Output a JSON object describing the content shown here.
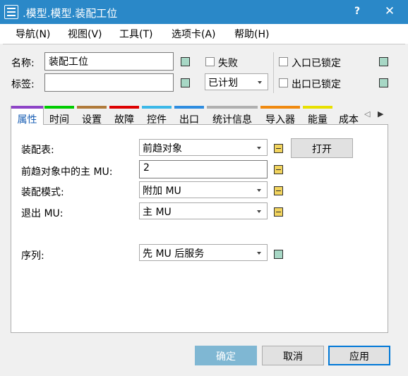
{
  "window": {
    "title": ".模型.模型.装配工位",
    "help_label": "?",
    "close_label": "✕",
    "app_icon": "station-icon"
  },
  "menu": [
    {
      "label": "导航(N)"
    },
    {
      "label": "视图(V)"
    },
    {
      "label": "工具(T)"
    },
    {
      "label": "选项卡(A)"
    },
    {
      "label": "帮助(H)"
    }
  ],
  "form": {
    "name_label": "名称:",
    "name_value": "装配工位",
    "tag_label": "标签:",
    "tag_value": "",
    "failed_label": "失败",
    "plan_value": "已计划",
    "entry_locked_label": "入口已锁定",
    "exit_locked_label": "出口已锁定"
  },
  "tabs": [
    {
      "label": "属性",
      "color": "#8e44c7",
      "active": true
    },
    {
      "label": "时间",
      "color": "#00cc00"
    },
    {
      "label": "设置",
      "color": "#b07a3a"
    },
    {
      "label": "故障",
      "color": "#dd0000"
    },
    {
      "label": "控件",
      "color": "#3cb8e8"
    },
    {
      "label": "出口",
      "color": "#2f8de0"
    },
    {
      "label": "统计信息",
      "color": "#b0b0b0"
    },
    {
      "label": "导入器",
      "color": "#f08a10"
    },
    {
      "label": "能量",
      "color": "#e8e000"
    },
    {
      "label": "成本",
      "color": "#a8e8a0"
    }
  ],
  "tab_scroll": {
    "left": "◁",
    "right": "▶"
  },
  "properties": {
    "assembly_table_label": "装配表:",
    "assembly_table_value": "前趋对象",
    "open_button": "打开",
    "main_mu_label": "前趋对象中的主 MU:",
    "main_mu_value": "2",
    "assembly_mode_label": "装配模式:",
    "assembly_mode_value": "附加 MU",
    "exit_mu_label": "退出 MU:",
    "exit_mu_value": "主 MU",
    "sequence_label": "序列:",
    "sequence_value": "先 MU 后服务"
  },
  "buttons": {
    "ok": "确定",
    "cancel": "取消",
    "apply": "应用"
  },
  "colors": {
    "titlebar": "#2a88c8",
    "ok_disabled": "#7fb7d3",
    "inherit_square": "#a7d7c5",
    "formula_square": "#f2d45e"
  }
}
